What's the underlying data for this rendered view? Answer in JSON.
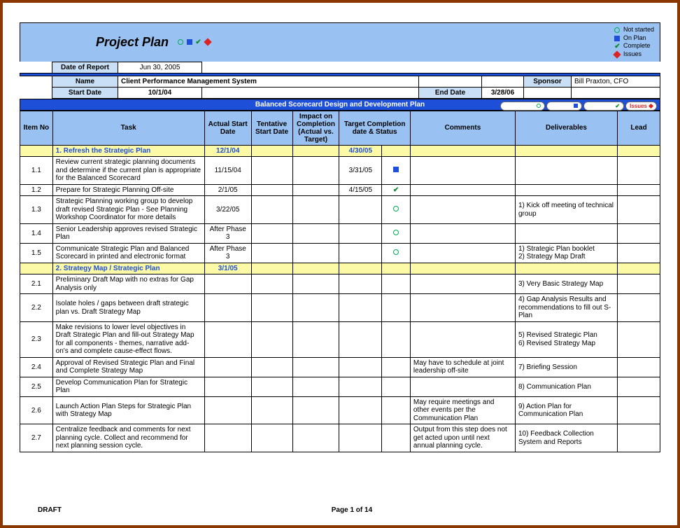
{
  "title": "Project Plan",
  "legend": {
    "not_started": "Not started",
    "on_plan": "On Plan",
    "complete": "Complete",
    "issues": "Issues"
  },
  "report": {
    "date_label": "Date of Report",
    "date_value": "Jun 30, 2005"
  },
  "meta": {
    "name_label": "Name",
    "name_value": "Client Performance Management System",
    "sponsor_label": "Sponsor",
    "sponsor_value": "Bill Praxton, CFO",
    "startdate_label": "Start Date",
    "startdate_value": "10/1/04",
    "enddate_label": "End Date",
    "enddate_value": "3/28/06"
  },
  "plan_title": "Balanced Scorecard Design and Development Plan",
  "filters": {
    "not_started": "Not Started",
    "on_plan": "On Plan",
    "complete": "Complete",
    "issues": "Issues"
  },
  "columns": {
    "item_no": "Item No",
    "task": "Task",
    "actual_start": "Actual Start Date",
    "tentative_start": "Tentative Start Date",
    "impact": "Impact on Completion (Actual vs. Target)",
    "target": "Target Completion date & Status",
    "comments": "Comments",
    "deliverables": "Deliverables",
    "lead": "Lead"
  },
  "sections": [
    {
      "title": "1. Refresh the Strategic Plan",
      "actual_start": "12/1/04",
      "target": "4/30/05",
      "rows": [
        {
          "no": "1.1",
          "task": "Review current strategic planning documents and determine if the current plan is appropriate for the Balanced Scorecard",
          "actual": "11/15/04",
          "tent": "",
          "impact": "",
          "target": "3/31/05",
          "status": "square",
          "comments": "",
          "deliv": "",
          "lead": ""
        },
        {
          "no": "1.2",
          "task": "Prepare for Strategic Planning Off-site",
          "actual": "2/1/05",
          "tent": "",
          "impact": "",
          "target": "4/15/05",
          "status": "check",
          "comments": "",
          "deliv": "",
          "lead": ""
        },
        {
          "no": "1.3",
          "task": "Strategic Planning working group to develop draft revised Strategic Plan - See Planning Workshop Coordinator for more details",
          "actual": "3/22/05",
          "tent": "",
          "impact": "",
          "target": "",
          "status": "circle",
          "comments": "",
          "deliv": "1) Kick off meeting of technical group",
          "lead": ""
        },
        {
          "no": "1.4",
          "task": "Senior Leadership approves revised Strategic Plan",
          "actual": "After Phase 3",
          "tent": "",
          "impact": "",
          "target": "",
          "status": "circle",
          "comments": "",
          "deliv": "",
          "lead": ""
        },
        {
          "no": "1.5",
          "task": "Communicate Strategic Plan and Balanced Scorecard in printed and electronic format",
          "actual": "After Phase 3",
          "tent": "",
          "impact": "",
          "target": "",
          "status": "circle",
          "comments": "",
          "deliv": "1) Strategic Plan booklet\n2) Strategy Map Draft",
          "lead": ""
        }
      ]
    },
    {
      "title": "2. Strategy Map / Strategic Plan",
      "actual_start": "3/1/05",
      "target": "",
      "rows": [
        {
          "no": "2.1",
          "task": "Preliminary Draft Map with no extras for Gap Analysis only",
          "actual": "",
          "tent": "",
          "impact": "",
          "target": "",
          "status": "",
          "comments": "",
          "deliv": "3) Very Basic Strategy Map",
          "lead": ""
        },
        {
          "no": "2.2",
          "task": "Isolate holes / gaps between draft strategic plan vs. Draft Strategy Map",
          "actual": "",
          "tent": "",
          "impact": "",
          "target": "",
          "status": "",
          "comments": "",
          "deliv": "4) Gap Analysis Results and recommendations to fill out S-Plan",
          "lead": ""
        },
        {
          "no": "2.3",
          "task": "Make revisions to lower level objectives in Draft Strategic Plan and fill-out Strategy Map for all components - themes, narrative add-on's and complete cause-effect flows.",
          "actual": "",
          "tent": "",
          "impact": "",
          "target": "",
          "status": "",
          "comments": "",
          "deliv": "5) Revised Strategic Plan\n6) Revised Strategy Map",
          "lead": ""
        },
        {
          "no": "2.4",
          "task": "Approval of Revised Strategic Plan and Final and Complete Strategy Map",
          "actual": "",
          "tent": "",
          "impact": "",
          "target": "",
          "status": "",
          "comments": "May have to schedule at joint leadership off-site",
          "deliv": "7) Briefing Session",
          "lead": ""
        },
        {
          "no": "2.5",
          "task": "Develop Communication Plan for Strategic Plan",
          "actual": "",
          "tent": "",
          "impact": "",
          "target": "",
          "status": "",
          "comments": "",
          "deliv": "8) Communication Plan",
          "lead": ""
        },
        {
          "no": "2.6",
          "task": "Launch Action Plan Steps for Strategic Plan with Strategy Map",
          "actual": "",
          "tent": "",
          "impact": "",
          "target": "",
          "status": "",
          "comments": "May require meetings and other events per the Communication Plan",
          "deliv": "9) Action Plan for Communication Plan",
          "lead": ""
        },
        {
          "no": "2.7",
          "task": "Centralize feedback and comments for next planning cycle. Collect and recommend for next planning session cycle.",
          "actual": "",
          "tent": "",
          "impact": "",
          "target": "",
          "status": "",
          "comments": "Output from this step does not get acted upon until next annual planning cycle.",
          "deliv": "10) Feedback Collection System and Reports",
          "lead": ""
        }
      ]
    }
  ],
  "footer": {
    "left": "DRAFT",
    "center": "Page 1 of 14"
  }
}
